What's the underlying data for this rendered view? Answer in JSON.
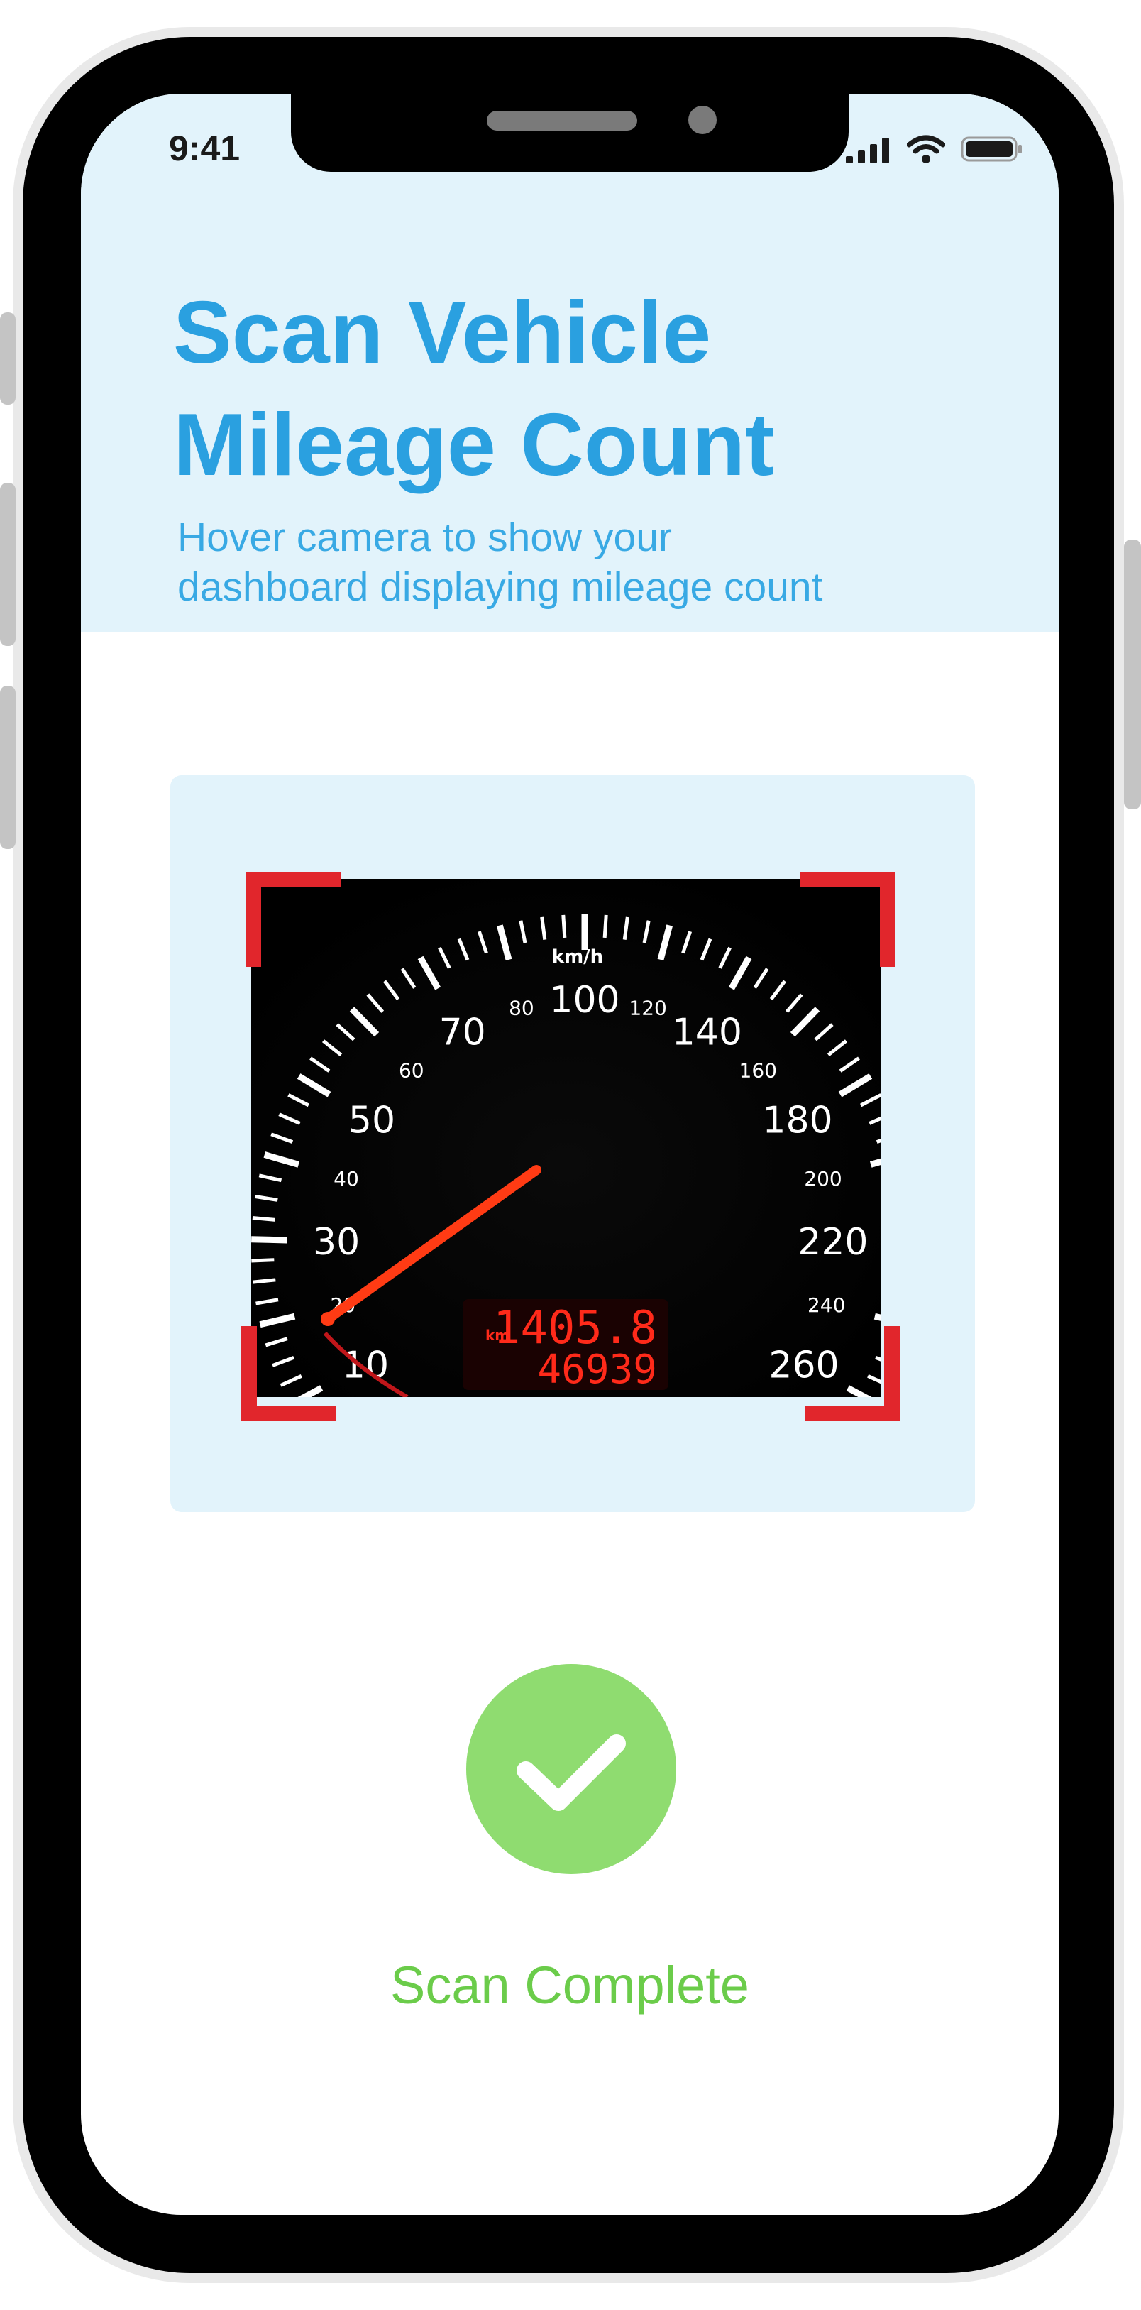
{
  "status_bar": {
    "time": "9:41",
    "icons": [
      "signal-bars-icon",
      "wifi-icon",
      "battery-icon"
    ]
  },
  "header": {
    "title_line1": "Scan Vehicle",
    "title_line2": "Mileage Count",
    "subtitle_line1": "Hover camera to show your",
    "subtitle_line2": "dashboard displaying mileage count"
  },
  "scanner": {
    "speedometer": {
      "unit": "km/h",
      "ticks_left": [
        {
          "label": "10",
          "size": "large"
        },
        {
          "label": "20",
          "size": "small"
        },
        {
          "label": "30",
          "size": "large"
        },
        {
          "label": "40",
          "size": "small"
        },
        {
          "label": "50",
          "size": "large"
        },
        {
          "label": "60",
          "size": "small"
        },
        {
          "label": "70",
          "size": "large"
        },
        {
          "label": "80",
          "size": "small"
        },
        {
          "label": "100",
          "size": "large"
        },
        {
          "label": "120",
          "size": "small"
        }
      ],
      "ticks_right": [
        {
          "label": "140",
          "size": "large"
        },
        {
          "label": "160",
          "size": "small"
        },
        {
          "label": "180",
          "size": "large"
        },
        {
          "label": "200",
          "size": "small"
        },
        {
          "label": "220",
          "size": "large"
        },
        {
          "label": "240",
          "size": "small"
        },
        {
          "label": "260",
          "size": "large"
        }
      ],
      "odometer_unit": "km",
      "trip": "1405.8",
      "total": "46939"
    },
    "colors": {
      "frame_bracket": "#e1262c",
      "needle": "#ff3b14",
      "display": "#ff2a1a"
    }
  },
  "result": {
    "icon": "checkmark-icon",
    "label": "Scan Complete",
    "color": "#8fdc70"
  },
  "colors": {
    "accent": "#2aa0e0",
    "header_bg": "#e2f3fb"
  }
}
